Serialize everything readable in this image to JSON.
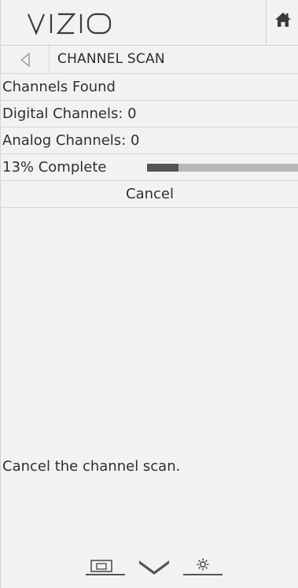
{
  "header": {
    "logo_text": "VIZIO",
    "home_icon": "home-icon"
  },
  "title_row": {
    "back_icon": "back-triangle-icon",
    "title": "CHANNEL SCAN"
  },
  "rows": {
    "channels_found": "Channels Found",
    "digital_channels": "Digital Channels: 0",
    "analog_channels": "Analog Channels: 0"
  },
  "progress": {
    "label": "13% Complete",
    "percent": 13
  },
  "cancel_label": "Cancel",
  "help_text": "Cancel the channel scan.",
  "bottom_bar": {
    "icons": [
      "picture-in-picture-icon",
      "vizio-v-icon",
      "gear-icon"
    ]
  },
  "colors": {
    "panel_background": "#f2f2f2",
    "progress_fill": "#555555",
    "progress_track": "#b9b9b9",
    "text": "#303030"
  }
}
